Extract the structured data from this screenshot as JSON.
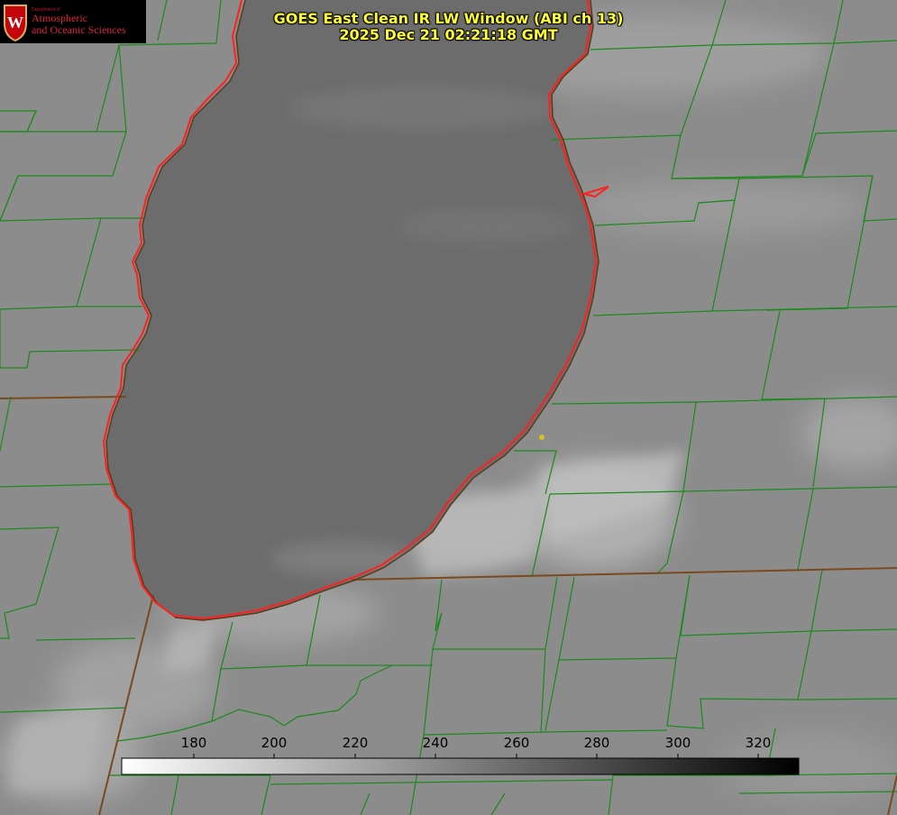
{
  "title": {
    "line1": "GOES East Clean IR LW Window (ABI ch 13)",
    "line2": "2025 Dec 21 02:21:18 GMT"
  },
  "logo": {
    "dept": "Department of",
    "line1": "Atmospheric",
    "line2": "and Oceanic Sciences",
    "seal_letter": "W"
  },
  "colorbar": {
    "ticks": [
      "180",
      "200",
      "220",
      "240",
      "260",
      "280",
      "300",
      "320"
    ],
    "range": [
      163,
      333
    ],
    "gradient": "white-to-black"
  },
  "colors": {
    "county_lines": "#1a8a1a",
    "state_lines": "#8b4513",
    "coastline": "#ff2020",
    "title_text": "#ffff33",
    "marker": "#d8c020"
  }
}
